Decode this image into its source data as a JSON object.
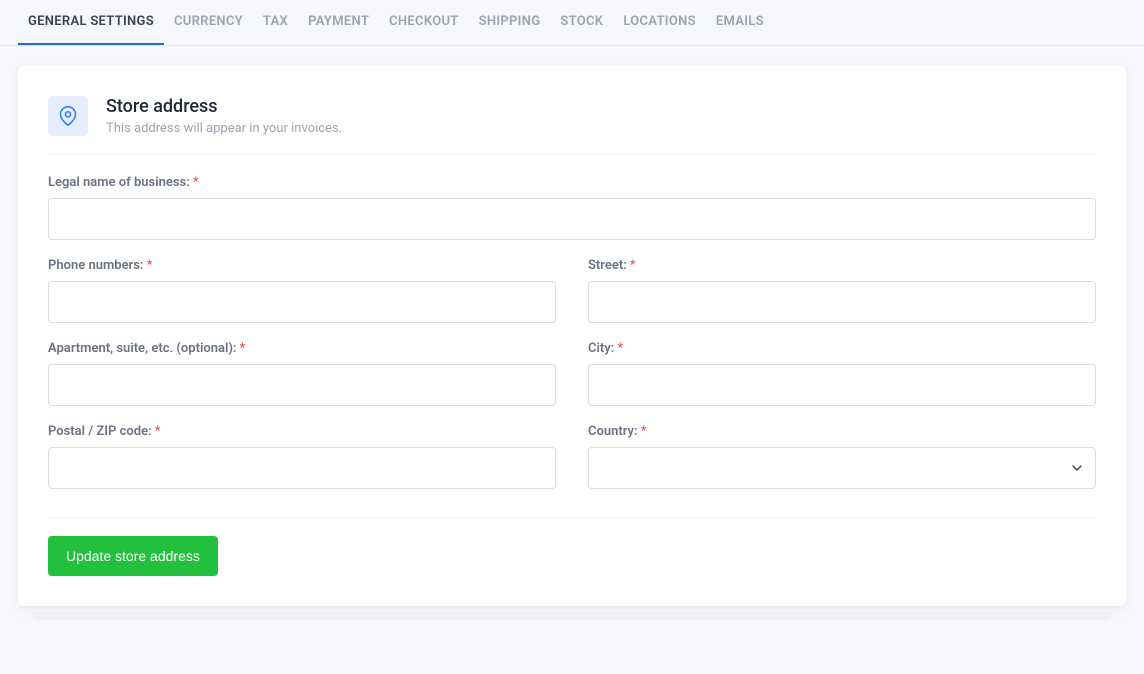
{
  "tabs": [
    {
      "label": "GENERAL SETTINGS",
      "active": true
    },
    {
      "label": "CURRENCY",
      "active": false
    },
    {
      "label": "TAX",
      "active": false
    },
    {
      "label": "PAYMENT",
      "active": false
    },
    {
      "label": "CHECKOUT",
      "active": false
    },
    {
      "label": "SHIPPING",
      "active": false
    },
    {
      "label": "STOCK",
      "active": false
    },
    {
      "label": "LOCATIONS",
      "active": false
    },
    {
      "label": "EMAILS",
      "active": false
    }
  ],
  "section": {
    "title": "Store address",
    "subtitle": "This address will appear in your invoices.",
    "icon": "location-pin-icon"
  },
  "fields": {
    "legal_name": {
      "label": "Legal name of business:",
      "required": true,
      "value": ""
    },
    "phone": {
      "label": "Phone numbers:",
      "required": true,
      "value": ""
    },
    "street": {
      "label": "Street:",
      "required": true,
      "value": ""
    },
    "apartment": {
      "label": "Apartment, suite, etc. (optional):",
      "required": true,
      "value": ""
    },
    "city": {
      "label": "City:",
      "required": true,
      "value": ""
    },
    "postal": {
      "label": "Postal / ZIP code:",
      "required": true,
      "value": ""
    },
    "country": {
      "label": "Country:",
      "required": true,
      "value": ""
    }
  },
  "required_mark": "*",
  "button": {
    "submit": "Update store address"
  }
}
